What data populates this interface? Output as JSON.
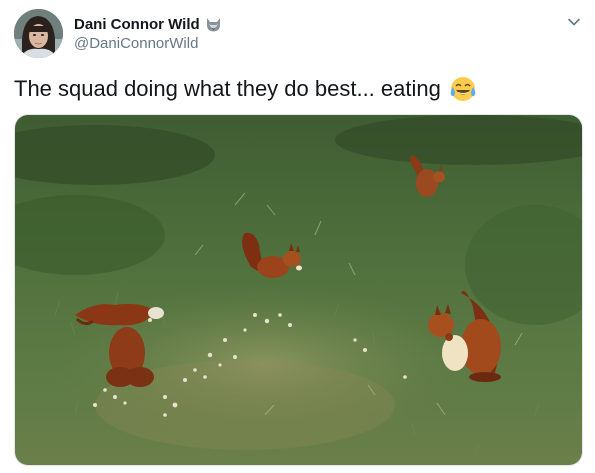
{
  "tweet": {
    "author": {
      "display_name": "Dani Connor Wild",
      "handle": "@DaniConnorWild",
      "badge_icon": "wolf-icon",
      "avatar_icon": "avatar-photo"
    },
    "text": "The squad doing what they do best... eating",
    "emoji_icon": "face-with-tears-of-joy-icon",
    "menu_icon": "chevron-down-icon",
    "media": {
      "description_icon": "squirrels-eating-photo"
    }
  },
  "colors": {
    "name": "#14171a",
    "handle": "#657786",
    "border": "#e1e8ed"
  }
}
